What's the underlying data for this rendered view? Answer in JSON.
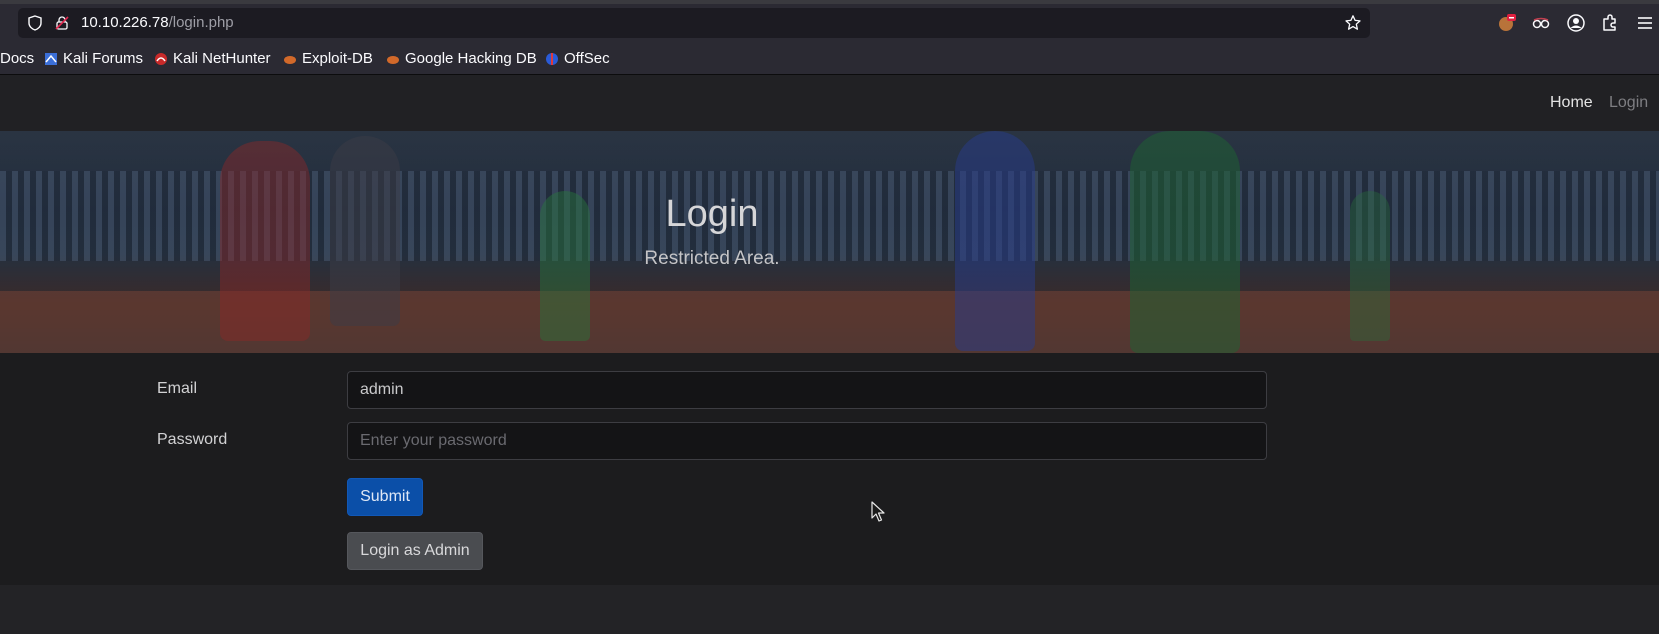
{
  "browser": {
    "url_host": "10.10.226.78",
    "url_path": "/login.php",
    "bookmarks": [
      {
        "label": "Docs",
        "icon": "none"
      },
      {
        "label": "Kali Forums",
        "icon": "kali-forums-icon"
      },
      {
        "label": "Kali NetHunter",
        "icon": "kali-nethunter-icon"
      },
      {
        "label": "Exploit-DB",
        "icon": "exploit-db-icon"
      },
      {
        "label": "Google Hacking DB",
        "icon": "ghdb-icon"
      },
      {
        "label": "OffSec",
        "icon": "offsec-icon"
      }
    ]
  },
  "navbar": {
    "home_label": "Home",
    "login_label": "Login"
  },
  "hero": {
    "title": "Login",
    "subtitle": "Restricted Area."
  },
  "form": {
    "email_label": "Email",
    "email_value": "admin",
    "password_label": "Password",
    "password_placeholder": "Enter your password",
    "submit_label": "Submit",
    "admin_login_label": "Login as Admin"
  },
  "colors": {
    "accent": "#0b4fa8",
    "page_bg": "#232326",
    "form_bg": "#1c1c1e"
  }
}
